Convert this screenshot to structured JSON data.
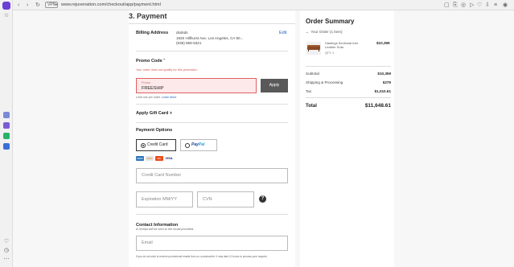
{
  "browser": {
    "url_badge": "VPN",
    "url": "www.rejuvenation.com/checkout/app/payment.html"
  },
  "page": {
    "title": "3. Payment"
  },
  "billing": {
    "title": "Billing Address",
    "edit": "Edit",
    "name": "dsdsds",
    "address": "1920 Hillhurst Ave, Los Angeles, CA 90...",
    "phone": "(938) 966-5321"
  },
  "promo": {
    "title": "Promo Code",
    "error": "Your order does not qualify for this promotion.",
    "label": "Promo",
    "value": "FREESHIP",
    "apply": "Apply",
    "limit": "Limit one per order.",
    "learn_more": "Learn More"
  },
  "gift_card": {
    "title": "Apply Gift Card"
  },
  "payment_options": {
    "title": "Payment Options",
    "credit_card": "Credit Card",
    "paypal_p1": "Pay",
    "paypal_p2": "Pal",
    "cards": [
      "AMEX",
      "DISC",
      "MC",
      "VISA"
    ]
  },
  "card_fields": {
    "number": "Credit Card Number",
    "expiration": "Expiration MM/YY",
    "cvn": "CVN",
    "help": "?"
  },
  "contact": {
    "title": "Contact Information",
    "subtitle": "A receipt will be sent to the email provided.",
    "email": "Email",
    "fine_print": "If you do not wish to receive promotional emails from us, unsubscribe. It may take 10 hours to process your request."
  },
  "summary": {
    "title": "Order Summary",
    "your_order": "Your Order (1 item)",
    "item_name": "Hastings Sectional Arm Leather Sofa",
    "item_qty": "QTY: 1",
    "item_price": "$10,359",
    "subtotal_label": "Subtotal",
    "subtotal": "$10,359",
    "shipping_label": "Shipping & Processing",
    "shipping": "$279",
    "tax_label": "Tax",
    "tax": "$1,010.61",
    "total_label": "Total",
    "total": "$11,648.61"
  },
  "colors": {
    "accent_link": "#1f5fbf",
    "error": "#d9534f",
    "apply_button": "#595959",
    "opera": "#6b3fd6"
  }
}
